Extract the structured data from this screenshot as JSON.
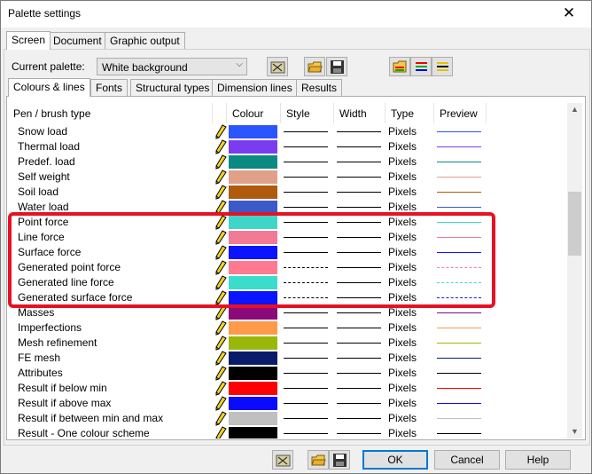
{
  "window": {
    "title": "Palette settings"
  },
  "top_tabs": [
    "Screen",
    "Document",
    "Graphic output"
  ],
  "palette": {
    "label": "Current palette:",
    "value": "White background"
  },
  "sub_tabs": [
    "Colours & lines",
    "Fonts",
    "Structural types",
    "Dimension lines",
    "Results"
  ],
  "columns": [
    "Pen / brush type",
    "Colour",
    "Style",
    "Width",
    "Type",
    "Preview"
  ],
  "rows": [
    {
      "name": "Snow load",
      "color": "#2b55ff",
      "style": "solid",
      "type": "Pixels",
      "preview": "#2b55ff"
    },
    {
      "name": "Thermal load",
      "color": "#7b3cf0",
      "style": "solid",
      "type": "Pixels",
      "preview": "#7b3cf0"
    },
    {
      "name": "Predef. load",
      "color": "#0a8a82",
      "style": "solid",
      "type": "Pixels",
      "preview": "#0a8a82"
    },
    {
      "name": "Self weight",
      "color": "#e0a08a",
      "style": "solid",
      "type": "Pixels",
      "preview": "#e0a08a"
    },
    {
      "name": "Soil load",
      "color": "#b05a0c",
      "style": "solid",
      "type": "Pixels",
      "preview": "#b05a0c"
    },
    {
      "name": "Water load",
      "color": "#3a5ac8",
      "style": "solid",
      "type": "Pixels",
      "preview": "#3a5ac8"
    },
    {
      "name": "Point force",
      "color": "#3fd6c8",
      "style": "solid",
      "type": "Pixels",
      "preview": "#3fd6c8"
    },
    {
      "name": "Line force",
      "color": "#f27a94",
      "style": "solid",
      "type": "Pixels",
      "preview": "#f27a94"
    },
    {
      "name": "Surface force",
      "color": "#0a14ff",
      "style": "solid",
      "type": "Pixels",
      "preview": "#0a14ff"
    },
    {
      "name": "Generated point force",
      "color": "#ff7a90",
      "style": "dash",
      "type": "Pixels",
      "preview": "#ff7a90"
    },
    {
      "name": "Generated line force",
      "color": "#3adccc",
      "style": "dash",
      "type": "Pixels",
      "preview": "#3adccc"
    },
    {
      "name": "Generated surface force",
      "color": "#0a14ff",
      "style": "dash",
      "type": "Pixels",
      "preview": "#0a14ff"
    },
    {
      "name": "Masses",
      "color": "#8a0a7a",
      "style": "solid",
      "type": "Pixels",
      "preview": "#8a0a7a"
    },
    {
      "name": "Imperfections",
      "color": "#ff9a4a",
      "style": "solid",
      "type": "Pixels",
      "preview": "#ff9a4a"
    },
    {
      "name": "Mesh refinement",
      "color": "#9ab80a",
      "style": "solid",
      "type": "Pixels",
      "preview": "#9ab80a"
    },
    {
      "name": "FE mesh",
      "color": "#0a1a6a",
      "style": "solid",
      "type": "Pixels",
      "preview": "#0a1a6a"
    },
    {
      "name": "Attributes",
      "color": "#000000",
      "style": "solid",
      "type": "Pixels",
      "preview": "#000000"
    },
    {
      "name": "Result if below min",
      "color": "#ff0000",
      "style": "solid",
      "type": "Pixels",
      "preview": "#ff0000"
    },
    {
      "name": "Result if above max",
      "color": "#0a0aff",
      "style": "solid",
      "type": "Pixels",
      "preview": "#0a0aff"
    },
    {
      "name": "Result if between min and max",
      "color": "#c0c0c0",
      "style": "solid",
      "type": "Pixels",
      "preview": "#c0c0c0"
    },
    {
      "name": "Result - One colour scheme",
      "color": "#000000",
      "style": "solid",
      "type": "Pixels",
      "preview": "#000000"
    }
  ],
  "buttons": {
    "ok": "OK",
    "cancel": "Cancel",
    "help": "Help"
  },
  "icons": {
    "reset": "reset-palette-icon",
    "open": "open-folder-icon",
    "save": "save-disk-icon",
    "palettes": [
      "palette-open-icon",
      "palette-lines-icon",
      "palette-colors-icon"
    ]
  },
  "colors": {
    "highlight": "#e81123",
    "default_button": "#0078d7"
  }
}
